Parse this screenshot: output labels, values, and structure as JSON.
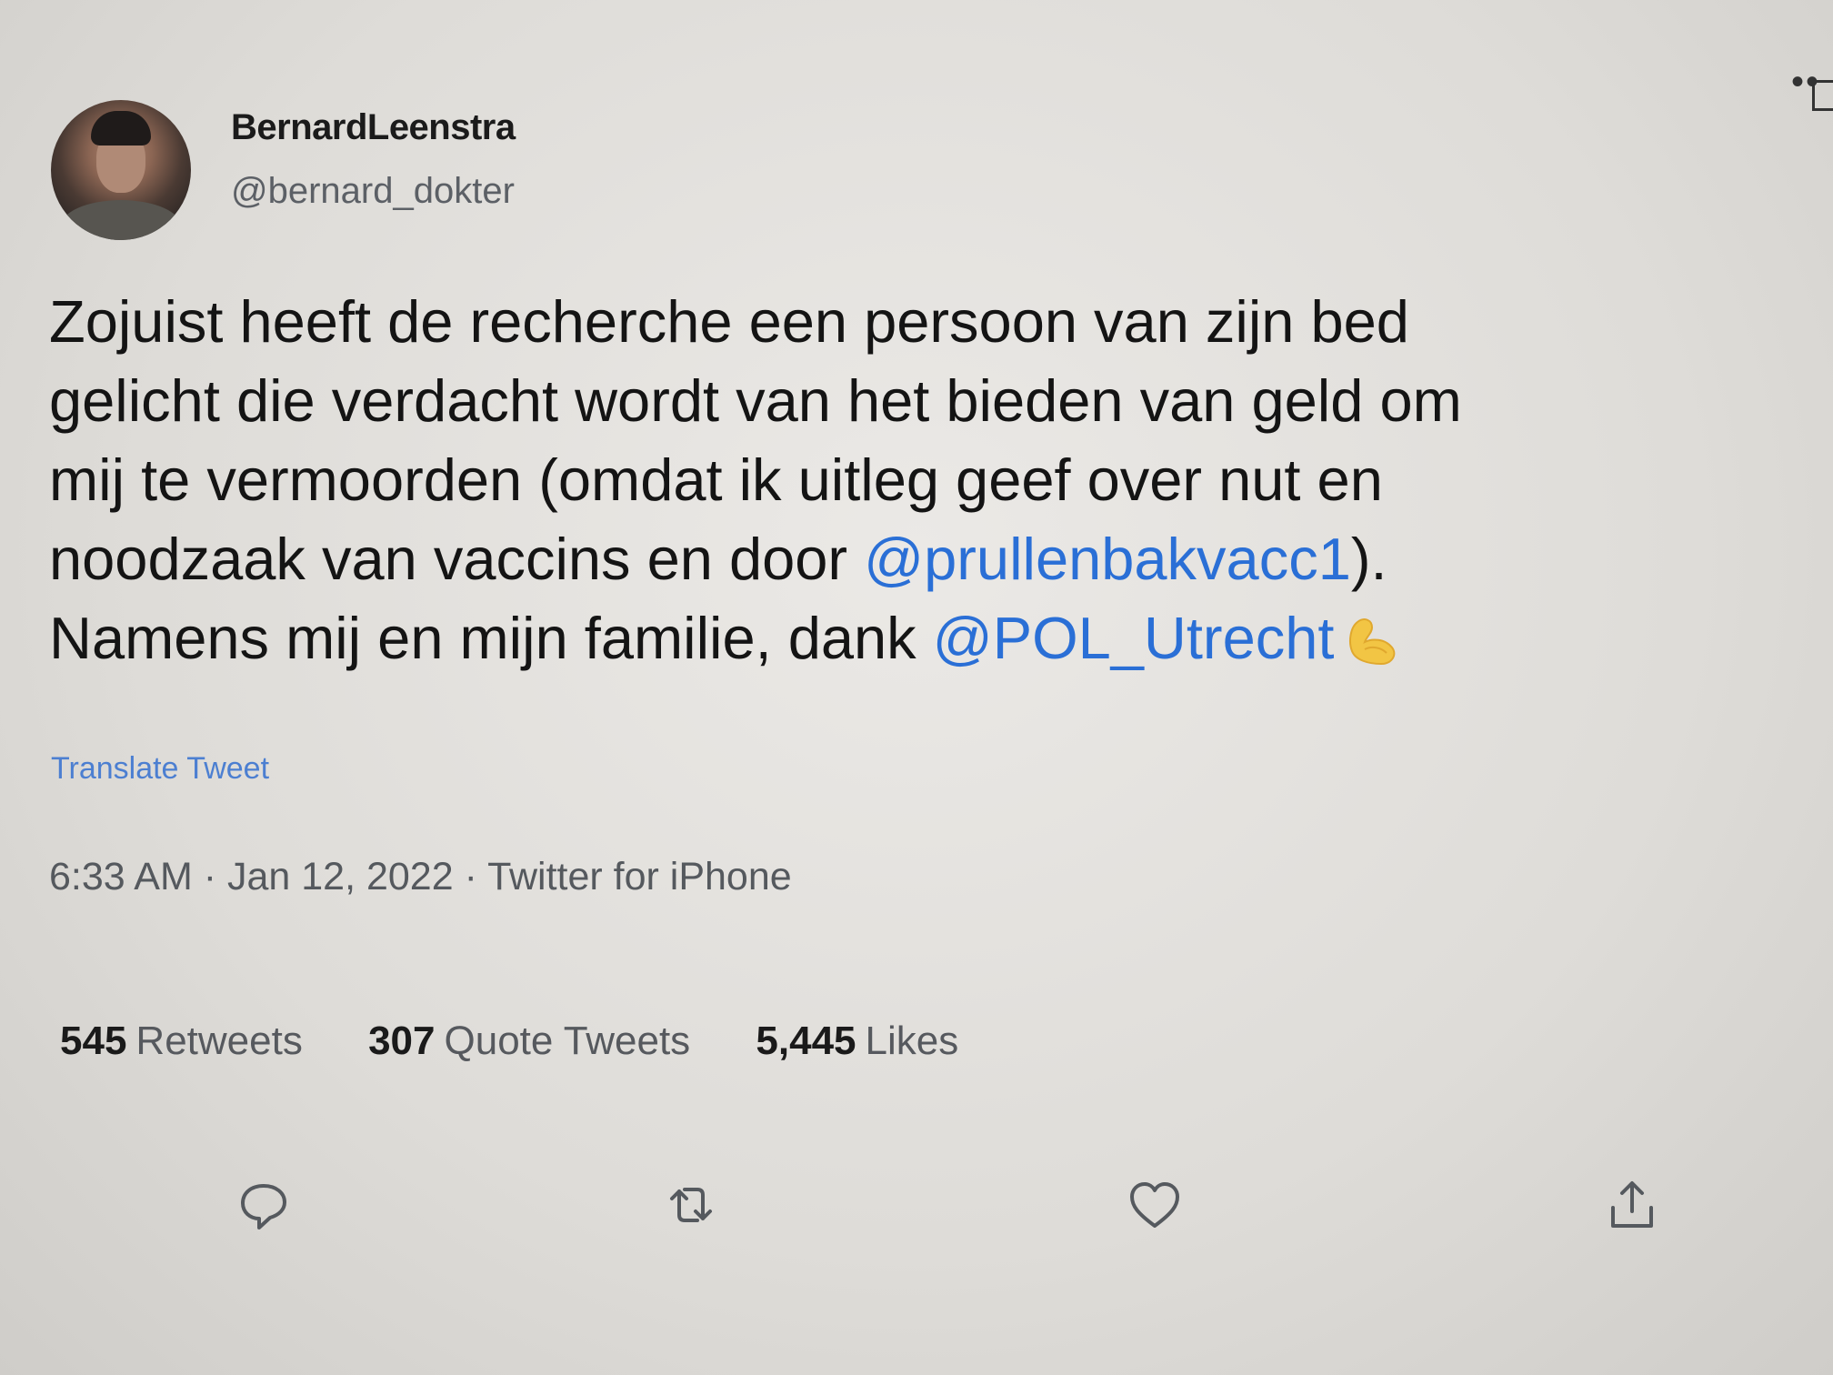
{
  "window": {
    "more_icon": "more-icon",
    "more_label": "••"
  },
  "author": {
    "display_name": "BernardLeenstra",
    "handle": "@bernard_dokter",
    "avatar_icon": "avatar"
  },
  "tweet": {
    "line1": "Zojuist heeft de recherche een persoon van zijn bed",
    "line2": "gelicht die verdacht wordt van het bieden van geld om",
    "line3": "mij te vermoorden (omdat ik uitleg geef over nut en",
    "line4_before": "noodzaak van vaccins en door ",
    "mention1": "@prullenbakvacc1",
    "line4_after": ").",
    "line5_before": "Namens mij en mijn familie, dank ",
    "mention2": "@POL_Utrecht",
    "emoji_icon": "flexed-biceps-emoji",
    "mention_color": "#2a6fd6"
  },
  "translate_label": "Translate Tweet",
  "meta": {
    "text": "6:33 AM · Jan 12, 2022 · Twitter for iPhone"
  },
  "stats": {
    "retweets_count": "545",
    "retweets_label": "Retweets",
    "quotes_count": "307",
    "quotes_label": "Quote Tweets",
    "likes_count": "5,445",
    "likes_label": "Likes"
  },
  "actions": {
    "reply_icon": "reply-icon",
    "retweet_icon": "retweet-icon",
    "like_icon": "heart-icon",
    "share_icon": "share-icon"
  }
}
